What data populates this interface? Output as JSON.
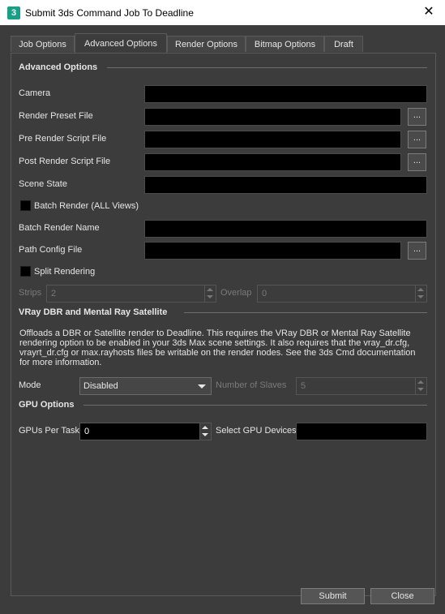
{
  "window": {
    "title": "Submit 3ds Command Job To Deadline",
    "app_icon_text": "3",
    "close_glyph": "✕"
  },
  "tabs": [
    {
      "label": "Job Options"
    },
    {
      "label": "Advanced Options",
      "active": true
    },
    {
      "label": "Render Options"
    },
    {
      "label": "Bitmap Options"
    },
    {
      "label": "Draft"
    }
  ],
  "advanced": {
    "section_title": "Advanced Options",
    "camera_label": "Camera",
    "render_preset_label": "Render Preset File",
    "pre_render_label": "Pre Render Script File",
    "post_render_label": "Post Render Script File",
    "scene_state_label": "Scene State",
    "batch_render_label": "Batch Render (ALL Views)",
    "batch_render_checked": false,
    "batch_render_name_label": "Batch Render Name",
    "path_config_label": "Path Config File",
    "split_rendering_label": "Split Rendering",
    "split_rendering_checked": false,
    "strips_label": "Strips",
    "strips_value": "2",
    "overlap_label": "Overlap",
    "overlap_value": "0",
    "browse_label": "..."
  },
  "vray": {
    "section_title": "VRay DBR and Mental Ray Satellite",
    "description": "Offloads a DBR or Satellite render to Deadline. This requires the VRay DBR or Mental Ray Satellite rendering option to be enabled in your 3ds Max scene settings. It also requires that the vray_dr.cfg, vrayrt_dr.cfg or max.rayhosts files be writable on the render nodes. See the 3ds Cmd documentation for more information.",
    "mode_label": "Mode",
    "mode_value": "Disabled",
    "slaves_label": "Number of Slaves",
    "slaves_value": "5"
  },
  "gpu": {
    "section_title": "GPU Options",
    "per_task_label": "GPUs Per Task",
    "per_task_value": "0",
    "devices_label": "Select GPU Devices"
  },
  "buttons": {
    "submit": "Submit",
    "close": "Close"
  }
}
